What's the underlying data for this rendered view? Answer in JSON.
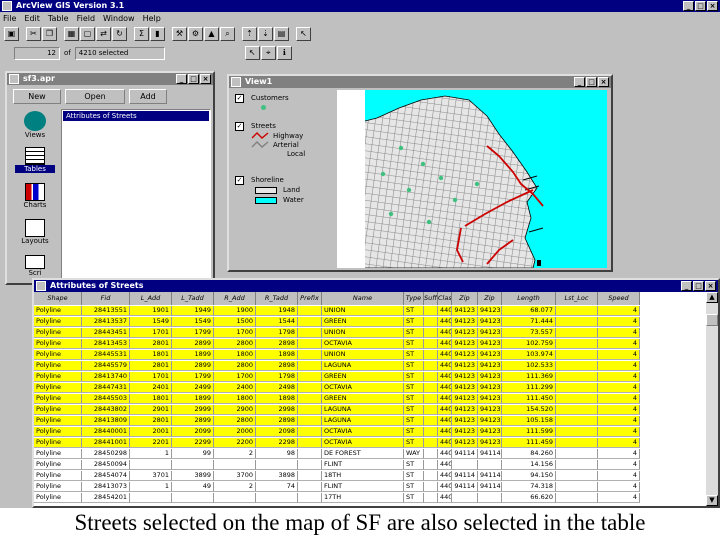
{
  "app": {
    "title": "ArcView GIS Version 3.1",
    "menus": [
      "File",
      "Edit",
      "Table",
      "Field",
      "Window",
      "Help"
    ],
    "records_selected_field": "12",
    "records_of": "of",
    "records_total": "4210 selected"
  },
  "project": {
    "title": "sf3.apr",
    "buttons": [
      "New",
      "Open",
      "Add"
    ],
    "icons": [
      {
        "label": "Views",
        "icon": "views-icon"
      },
      {
        "label": "Tables",
        "icon": "tables-icon"
      },
      {
        "label": "Charts",
        "icon": "charts-icon"
      },
      {
        "label": "Layouts",
        "icon": "layouts-icon"
      },
      {
        "label": "Scri",
        "icon": "scripts-icon"
      }
    ],
    "list_items": [
      "Attributes of Streets"
    ]
  },
  "view": {
    "title": "View1",
    "legend": {
      "customers": "Customers",
      "streets": "Streets",
      "highway": "Highway",
      "arterial": "Arterial",
      "local": "Local",
      "shoreline": "Shoreline",
      "land": "Land",
      "water": "Water"
    },
    "colors": {
      "water": "#00ffff",
      "land": "#e6e6e6",
      "streets": "#7f7f7f",
      "selected": "#cc0000",
      "customers": "#40c080"
    }
  },
  "table": {
    "title": "Attributes of Streets",
    "columns": [
      "Shape",
      "Fid",
      "L_Add",
      "L_Tadd",
      "R_Add",
      "R_Tadd",
      "Prefix",
      "Name",
      "Type",
      "Suffix",
      "Clas",
      "Zip",
      "Zip",
      "Length",
      "Lst_Loc",
      "Speed"
    ],
    "highlight_color": "#ffff00",
    "rows": [
      {
        "selected": true,
        "cells": [
          "Polyline",
          "28413551",
          "1901",
          "1949",
          "1900",
          "1948",
          "",
          "UNION",
          "ST",
          "",
          "440",
          "94123",
          "94123",
          "68.077",
          "",
          "4"
        ]
      },
      {
        "selected": true,
        "cells": [
          "Polyline",
          "28413537",
          "1549",
          "1549",
          "1500",
          "1544",
          "",
          "GREEN",
          "ST",
          "",
          "440",
          "94123",
          "94123",
          "71.444",
          "",
          "4"
        ]
      },
      {
        "selected": true,
        "cells": [
          "Polyline",
          "28443451",
          "1701",
          "1799",
          "1700",
          "1798",
          "",
          "UNION",
          "ST",
          "",
          "440",
          "94123",
          "94123",
          "73.557",
          "",
          "4"
        ]
      },
      {
        "selected": true,
        "cells": [
          "Polyline",
          "28413453",
          "2801",
          "2899",
          "2800",
          "2898",
          "",
          "OCTAVIA",
          "ST",
          "",
          "440",
          "94123",
          "94123",
          "102.759",
          "",
          "4"
        ]
      },
      {
        "selected": true,
        "cells": [
          "Polyline",
          "28445531",
          "1801",
          "1899",
          "1800",
          "1898",
          "",
          "UNION",
          "ST",
          "",
          "440",
          "94123",
          "94123",
          "103.974",
          "",
          "4"
        ]
      },
      {
        "selected": true,
        "cells": [
          "Polyline",
          "28445579",
          "2801",
          "2899",
          "2800",
          "2898",
          "",
          "LAGUNA",
          "ST",
          "",
          "440",
          "94123",
          "94123",
          "102.533",
          "",
          "4"
        ]
      },
      {
        "selected": true,
        "cells": [
          "Polyline",
          "28413740",
          "1701",
          "1799",
          "1700",
          "1798",
          "",
          "GREEN",
          "ST",
          "",
          "440",
          "94123",
          "94123",
          "111.369",
          "",
          "4"
        ]
      },
      {
        "selected": true,
        "cells": [
          "Polyline",
          "28447431",
          "2401",
          "2499",
          "2400",
          "2498",
          "",
          "OCTAVIA",
          "ST",
          "",
          "440",
          "94123",
          "94123",
          "111.299",
          "",
          "4"
        ]
      },
      {
        "selected": true,
        "cells": [
          "Polyline",
          "28445503",
          "1801",
          "1899",
          "1800",
          "1898",
          "",
          "GREEN",
          "ST",
          "",
          "440",
          "94123",
          "94123",
          "111.450",
          "",
          "4"
        ]
      },
      {
        "selected": true,
        "cells": [
          "Polyline",
          "28443802",
          "2901",
          "2999",
          "2900",
          "2998",
          "",
          "LAGUNA",
          "ST",
          "",
          "440",
          "94123",
          "94123",
          "154.520",
          "",
          "4"
        ]
      },
      {
        "selected": true,
        "cells": [
          "Polyline",
          "28413809",
          "2801",
          "2899",
          "2800",
          "2898",
          "",
          "LAGUNA",
          "ST",
          "",
          "440",
          "94123",
          "94123",
          "105.158",
          "",
          "4"
        ]
      },
      {
        "selected": true,
        "cells": [
          "Polyline",
          "28440001",
          "2001",
          "2099",
          "2000",
          "2098",
          "",
          "OCTAVIA",
          "ST",
          "",
          "440",
          "94123",
          "94123",
          "111.599",
          "",
          "4"
        ]
      },
      {
        "selected": true,
        "cells": [
          "Polyline",
          "28441001",
          "2201",
          "2299",
          "2200",
          "2298",
          "",
          "OCTAVIA",
          "ST",
          "",
          "440",
          "94123",
          "94123",
          "111.459",
          "",
          "4"
        ]
      },
      {
        "selected": false,
        "cells": [
          "Polyline",
          "28450298",
          "1",
          "99",
          "2",
          "98",
          "",
          "DE FOREST",
          "WAY",
          "",
          "440",
          "94114",
          "94114",
          "84.260",
          "",
          "4"
        ]
      },
      {
        "selected": false,
        "cells": [
          "Polyline",
          "28450094",
          "",
          "",
          "",
          "",
          "",
          "FLINT",
          "ST",
          "",
          "440",
          "",
          "",
          "14.156",
          "",
          "4"
        ]
      },
      {
        "selected": false,
        "cells": [
          "Polyline",
          "28454074",
          "3701",
          "3899",
          "3700",
          "3898",
          "",
          "18TH",
          "ST",
          "",
          "440",
          "94114",
          "94114",
          "94.150",
          "",
          "4"
        ]
      },
      {
        "selected": false,
        "cells": [
          "Polyline",
          "28413073",
          "1",
          "49",
          "2",
          "74",
          "",
          "FLINT",
          "ST",
          "",
          "440",
          "94114",
          "94114",
          "74.318",
          "",
          "4"
        ]
      },
      {
        "selected": false,
        "cells": [
          "Polyline",
          "28454201",
          "",
          "",
          "",
          "",
          "",
          "17TH",
          "ST",
          "",
          "440",
          "",
          "",
          "66.620",
          "",
          "4"
        ]
      }
    ]
  },
  "caption": "Streets selected on the map of SF are also selected in the table"
}
